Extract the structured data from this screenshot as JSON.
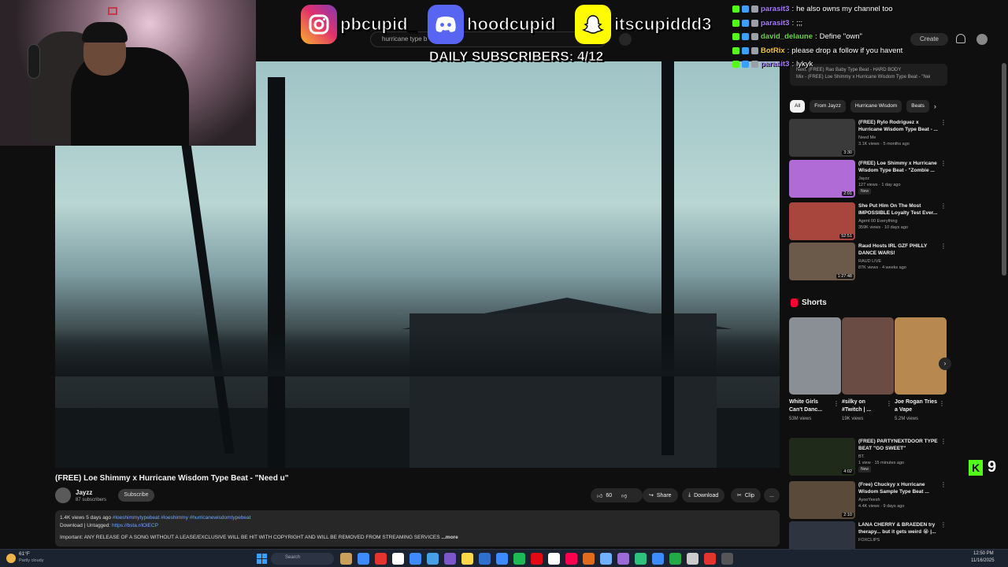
{
  "youtube": {
    "search_text": "hurricane type b",
    "create_label": "Create"
  },
  "overlay": {
    "socials": [
      {
        "icon": "instagram-icon",
        "handle": "pbcupid_"
      },
      {
        "icon": "discord-icon",
        "handle": "hoodcupid"
      },
      {
        "icon": "snapchat-icon",
        "handle": "itscupiddd3"
      }
    ],
    "daily_subscribers": "DAILY SUBSCRIBERS: 4/12",
    "kick_count": "9"
  },
  "chat": [
    {
      "user": "parasit3",
      "sep": " : ",
      "message": "he also owns my channel too",
      "user_color": "#a57bf5"
    },
    {
      "user": "parasit3",
      "sep": " : ",
      "message": ";;;",
      "user_color": "#a57bf5"
    },
    {
      "user": "david_delaune",
      "sep": " : ",
      "message": "Define \"own\"",
      "user_color": "#6fd14a"
    },
    {
      "user": "BotRix",
      "sep": " : ",
      "message": "please drop a follow if you havent",
      "user_color": "#f5c542"
    },
    {
      "user": "parasit3",
      "sep": " : ",
      "message": "lykyk",
      "user_color": "#a57bf5"
    }
  ],
  "video": {
    "title": "(FREE) Loe Shimmy x Hurricane Wisdom Type Beat - \"Need u\"",
    "channel": "Jayzz",
    "subscribers": "87 subscribers",
    "subscribe_label": "Subscribe",
    "likes": "60",
    "share_label": "Share",
    "download_label": "Download",
    "clip_label": "Clip",
    "more_label": "...",
    "description": {
      "views_age": "1.4K views  5 days ago",
      "hashtags": "#loeshimmytypebeat #loeshimmy #hurricanewisdomtypebeat",
      "download_text": "Download | Untagged:",
      "download_link": "https://bsta.r/lOlECP",
      "notice": "Important: ANY RELEASE OF A SONG WITHOUT A LEASE/EXCLUSIVE WILL BE HIT WITH COPYRIGHT AND WILL BE REMOVED FROM STREAMING SERVICES",
      "more": "...more"
    }
  },
  "sidebar": {
    "banner_line1": "Next: (FREE) Rao Baby Type Beat - HARD BODY",
    "banner_line2": "Mix - (FREE) Loe Shimmy x Hurricane Wisdom Type Beat - \"Nei",
    "chips": [
      "All",
      "From Jayzz",
      "Hurricane Wisdom",
      "Beats"
    ],
    "recommendations": [
      {
        "title": "(FREE) Rylo Rodriguez x Hurricane Wisdom Type Beat - ...",
        "channel": "Need Me",
        "stats": "3.1K views · 5 months ago",
        "duration": "3:30",
        "badge": "",
        "color": "#3a3a3a"
      },
      {
        "title": "(FREE) Loe Shimmy x Hurricane Wisdom Type Beat - \"Zombie ...",
        "channel": "Jayzz",
        "stats": "127 views · 1 day ago",
        "duration": "2:01",
        "badge": "New",
        "color": "#b06bd6"
      },
      {
        "title": "She Put Him On The Most IMPOSSIBLE Loyalty Test Ever...",
        "channel": "Agent 00 Everything",
        "stats": "359K views · 10 days ago",
        "duration": "52:51",
        "badge": "",
        "color": "#a8453c"
      },
      {
        "title": "Raud Hosts IRL GZF PHILLY DANCE WARS!",
        "channel": "RAUD LIVE",
        "stats": "87K views · 4 weeks ago",
        "duration": "1:27:48",
        "badge": "",
        "color": "#6b5a4a"
      }
    ],
    "shorts_title": "Shorts",
    "shorts": [
      {
        "title": "White Girls Can't Danc...",
        "views": "53M views",
        "color": "#8a8f95"
      },
      {
        "title": "#silky on #Twitch | ...",
        "views": "19K views",
        "color": "#6b4c45"
      },
      {
        "title": "Joe Rogan Tries a Vape",
        "views": "5.2M views",
        "color": "#b7884f"
      }
    ],
    "more_recommendations": [
      {
        "title": "(FREE) PARTYNEXTDOOR TYPE BEAT \"GO SWEET\"",
        "channel": "BT.",
        "stats": "1 view · 15 minutes ago",
        "duration": "4:02",
        "badge": "New",
        "color": "#1f2a1a"
      },
      {
        "title": "(Free) Chuckyy x Hurricane Wisdom Sample Type Beat ...",
        "channel": "AyooYeesh",
        "stats": "4.4K views · 9 days ago",
        "duration": "2:10",
        "badge": "",
        "color": "#5a4a3a"
      },
      {
        "title": "LANA CHERRY & BRAEDEN try therapy... but it gets weird 😭 |...",
        "channel": "FOXCLIPS",
        "stats": "",
        "duration": "",
        "badge": "",
        "color": "#2e3440"
      }
    ]
  },
  "taskbar": {
    "temperature": "61°F",
    "weather": "Partly cloudy",
    "search_placeholder": "Search",
    "time": "12:50 PM",
    "date": "11/16/2025",
    "apps": [
      "#c9a15a",
      "#3d8bff",
      "#e3342f",
      "#ffffff",
      "#3d8bff",
      "#45a0e6",
      "#7a58c9",
      "#ffd84a",
      "#2f6fd1",
      "#3d8bff",
      "#1db954",
      "#e50914",
      "#ffffff",
      "#ff0050",
      "#e06a1d",
      "#6fb0ff",
      "#9b6bd6",
      "#2ec27e",
      "#3d8bff",
      "#22aa44",
      "#cccccc",
      "#e3342f",
      "#555555"
    ]
  }
}
